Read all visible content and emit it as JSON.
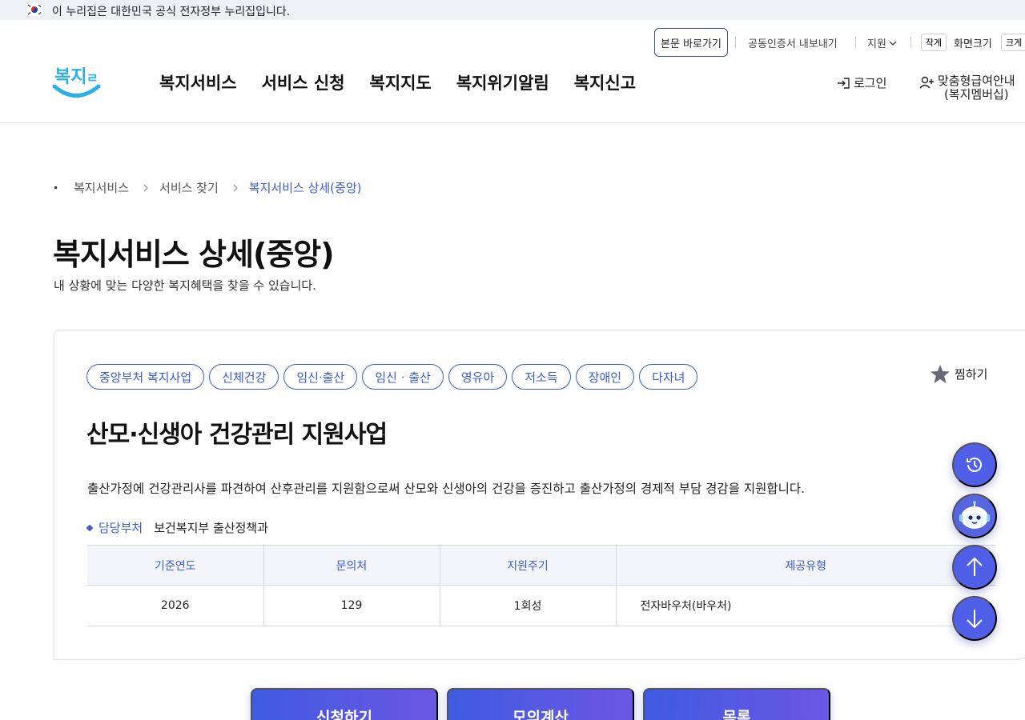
{
  "gov_banner": {
    "text": "이 누리집은 대한민국 공식 전자정부 누리집입니다."
  },
  "utility": {
    "skip_to_content": "본문 바로가기",
    "cert_export": "공동인증서 내보내기",
    "support": "지원",
    "font_small": "작게",
    "font_size_label": "화면크기",
    "font_large": "크게"
  },
  "logo": {
    "text": "복지로"
  },
  "gnb": [
    {
      "label": "복지서비스"
    },
    {
      "label": "서비스 신청"
    },
    {
      "label": "복지지도"
    },
    {
      "label": "복지위기알림"
    },
    {
      "label": "복지신고"
    }
  ],
  "account": {
    "login": "로그인",
    "member_line1": "맞춤형급여안내",
    "member_line2": "(복지멤버십)"
  },
  "breadcrumb": [
    "복지서비스",
    "서비스 찾기",
    "복지서비스 상세(중앙)"
  ],
  "page": {
    "title": "복지서비스 상세(중앙)",
    "description": "내 상황에 맞는 다양한 복지혜택을 찾을 수 있습니다."
  },
  "service": {
    "tags": [
      "중앙부처 복지사업",
      "신체건강",
      "임신·출산",
      "임신 · 출산",
      "영유아",
      "저소득",
      "장애인",
      "다자녀"
    ],
    "favorite_label": "찜하기",
    "title": "산모·신생아 건강관리 지원사업",
    "description": "출산가정에 건강관리사를 파견하여 산후관리를 지원함으로써 산모와 신생아의 건강을 증진하고 출산가정의 경제적 부담 경감을 지원합니다.",
    "dept_label": "담당부처",
    "dept_value": "보건복지부 출산정책과",
    "table": {
      "headers": [
        "기준연도",
        "문의처",
        "지원주기",
        "제공유형"
      ],
      "row": [
        "2026",
        "129",
        "1회성",
        "전자바우처(바우처)"
      ]
    }
  },
  "floating": {
    "history": "history-icon",
    "chatbot": "chatbot-icon",
    "scroll_up": "arrow-up-icon",
    "scroll_down": "arrow-down-icon"
  },
  "actions": {
    "apply": "신청하기",
    "simulate": "모의계산",
    "list": "목록"
  },
  "colors": {
    "accent": "#3b5bdb",
    "fab": "#4f5fe8",
    "logo": "#2bb0e6"
  }
}
